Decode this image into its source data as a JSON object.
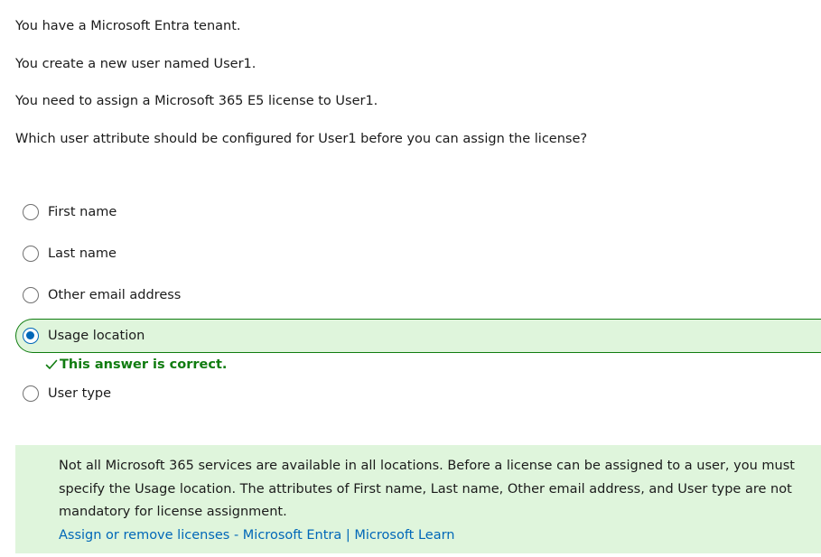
{
  "question": {
    "lines": [
      "You have a Microsoft Entra tenant.",
      "You create a new user named User1.",
      "You need to assign a Microsoft 365 E5 license to User1.",
      "Which user attribute should be configured for User1 before you can assign the license?"
    ]
  },
  "options": [
    {
      "label": "First name",
      "selected": false
    },
    {
      "label": "Last name",
      "selected": false
    },
    {
      "label": "Other email address",
      "selected": false
    },
    {
      "label": "Usage location",
      "selected": true
    },
    {
      "label": "User type",
      "selected": false
    }
  ],
  "feedback": {
    "text": "This answer is correct.",
    "icon": "checkmark-icon",
    "color": "#107c10"
  },
  "explanation": {
    "text": "Not all Microsoft 365 services are available in all locations. Before a license can be assigned to a user, you must specify the Usage location. The attributes of First name, Last name, Other email address, and User type are not mandatory for license assignment.",
    "link_text": "Assign or remove licenses - Microsoft Entra | Microsoft Learn"
  },
  "colors": {
    "correct_bg": "#dff5dc",
    "correct_border": "#107c10",
    "accent": "#0067b8"
  }
}
